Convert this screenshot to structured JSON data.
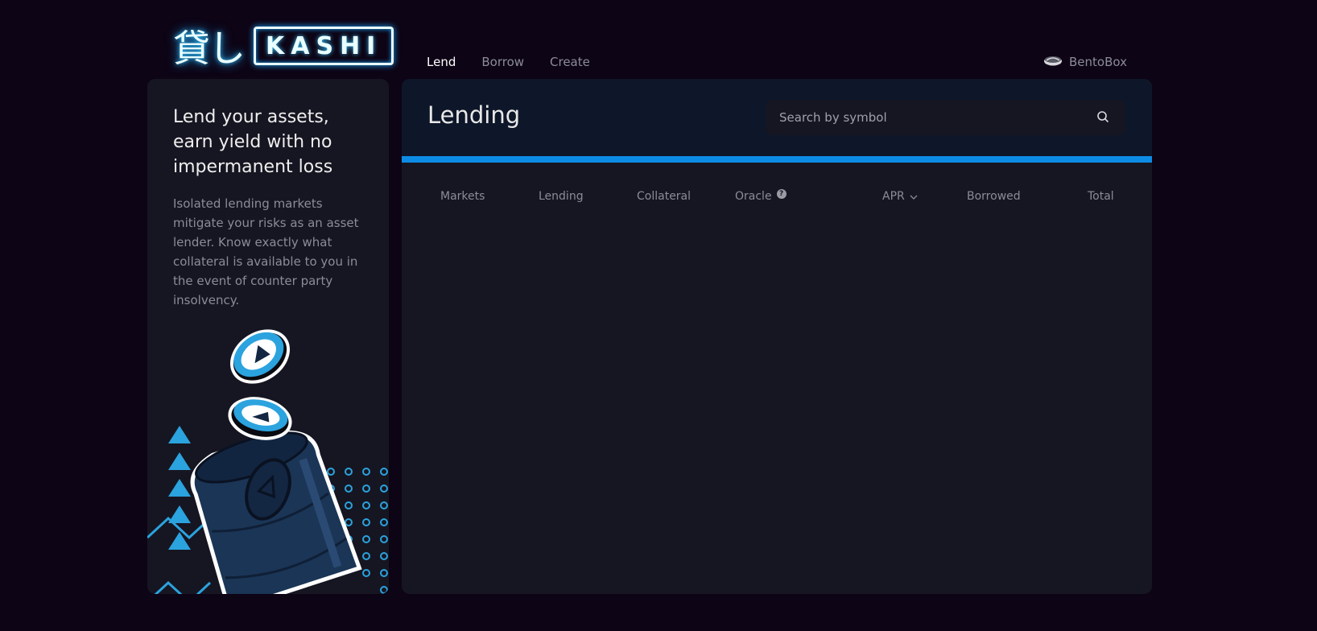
{
  "brand": {
    "kanji": "貸し",
    "name": "KASHI"
  },
  "nav": {
    "items": [
      "Lend",
      "Borrow",
      "Create"
    ],
    "active": "Lend"
  },
  "bentobox": {
    "label": "BentoBox"
  },
  "sidebar": {
    "title": "Lend your assets, earn yield with no impermanent loss",
    "description": "Isolated lending markets mitigate your risks as an asset lender. Know exactly what collateral is available to you in the event of counter party insolvency."
  },
  "main": {
    "title": "Lending",
    "search": {
      "placeholder": "Search by symbol",
      "value": ""
    },
    "columns": [
      "Markets",
      "Lending",
      "Collateral",
      "Oracle",
      "APR",
      "Borrowed",
      "Total"
    ],
    "oracle_help": "?"
  },
  "colors": {
    "background": "#0d0415",
    "card": "#161622",
    "header": "#0e1729",
    "accent": "#0d8ce6"
  }
}
